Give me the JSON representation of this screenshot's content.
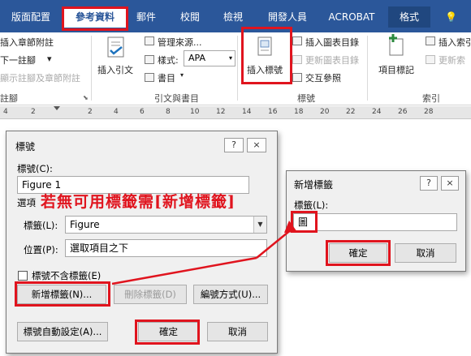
{
  "ribbon": {
    "tabs": [
      "版面配置",
      "參考資料",
      "郵件",
      "校閱",
      "檢視",
      "開發人員",
      "ACROBAT",
      "格式"
    ],
    "active_tab": "參考資料",
    "tell_icon": "lightbulb-icon",
    "left_items": [
      "插入章節附註",
      "下一註腳",
      "顯示註腳及章節附註"
    ],
    "left_group": "註腳",
    "insert_citation": "插入引文",
    "manage_sources": "管理來源...",
    "style_label": "樣式:",
    "style_value": "APA",
    "bibliography": "書目",
    "citations_group": "引文與書目",
    "insert_caption": "插入標號",
    "insert_table_of_figures": "插入圖表目錄",
    "update_table": "更新圖表目錄",
    "cross_reference": "交互參照",
    "captions_group": "標號",
    "mark_entry": "項目標記",
    "insert_index": "插入索引",
    "update_index": "更新索",
    "index_group": "索引"
  },
  "ruler": {
    "marks": [
      "4",
      "2",
      "2",
      "4",
      "6",
      "8",
      "10",
      "12",
      "14",
      "16",
      "18",
      "20",
      "22",
      "24",
      "26",
      "28"
    ]
  },
  "caption_dialog": {
    "title": "標號",
    "help": "?",
    "close": "×",
    "caption_label": "標號(C):",
    "caption_value": "Figure 1",
    "options_label": "選項",
    "label_label": "標籤(L):",
    "label_value": "Figure",
    "position_label": "位置(P):",
    "position_value": "選取項目之下",
    "exclude_label": "標號不含標籤(E)",
    "new_label_btn": "新增標籤(N)...",
    "delete_label_btn": "刪除標籤(D)",
    "numbering_btn": "編號方式(U)...",
    "autocaption_btn": "標號自動設定(A)...",
    "ok": "確定",
    "cancel": "取消"
  },
  "new_label_dialog": {
    "title": "新增標籤",
    "help": "?",
    "close": "×",
    "label_label": "標籤(L):",
    "label_value": "圖",
    "ok": "確定",
    "cancel": "取消"
  },
  "annotation": {
    "text": "若無可用標籤需[新增標籤]",
    "color": "#e0141e"
  },
  "colors": {
    "ribbon": "#2b579a",
    "highlight": "#e0141e"
  }
}
